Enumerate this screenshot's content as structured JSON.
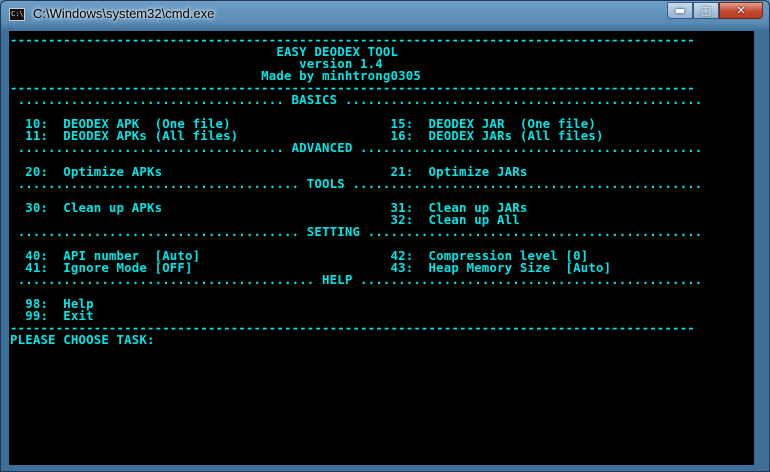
{
  "window": {
    "title": "C:\\Windows\\system32\\cmd.exe",
    "icon_text": "C:\\",
    "minimize_glyph": "▬",
    "maximize_glyph": "□",
    "close_glyph": "✕"
  },
  "console": {
    "lines": [
      "------------------------------------------------------------------------------------------",
      "                                   EASY DEODEX TOOL",
      "                                      version 1.4",
      "                                 Made by minhtrong0305",
      "------------------------------------------------------------------------------------------",
      " ................................... BASICS ...............................................",
      "",
      "  10:  DEODEX APK  (One file)                     15:  DEODEX JAR  (One file)",
      "  11:  DEODEX APKs (All files)                    16:  DEODEX JARs (All files)",
      " ................................... ADVANCED .............................................",
      "",
      "  20:  Optimize APKs                              21:  Optimize JARs",
      " ..................................... TOOLS ..............................................",
      "",
      "  30:  Clean up APKs                              31:  Clean up JARs",
      "                                                  32:  Clean up All",
      " ..................................... SETTING ............................................",
      "",
      "  40:  API number  [Auto]                         42:  Compression level [0]",
      "  41:  Ignore Mode [OFF]                          43:  Heap Memory Size  [Auto]",
      " ....................................... HELP .............................................",
      "",
      "  98:  Help",
      "  99:  Exit",
      "------------------------------------------------------------------------------------------",
      "PLEASE CHOOSE TASK:"
    ]
  },
  "colors": {
    "console_text": "#00e5e5",
    "console_bg": "#000000"
  }
}
